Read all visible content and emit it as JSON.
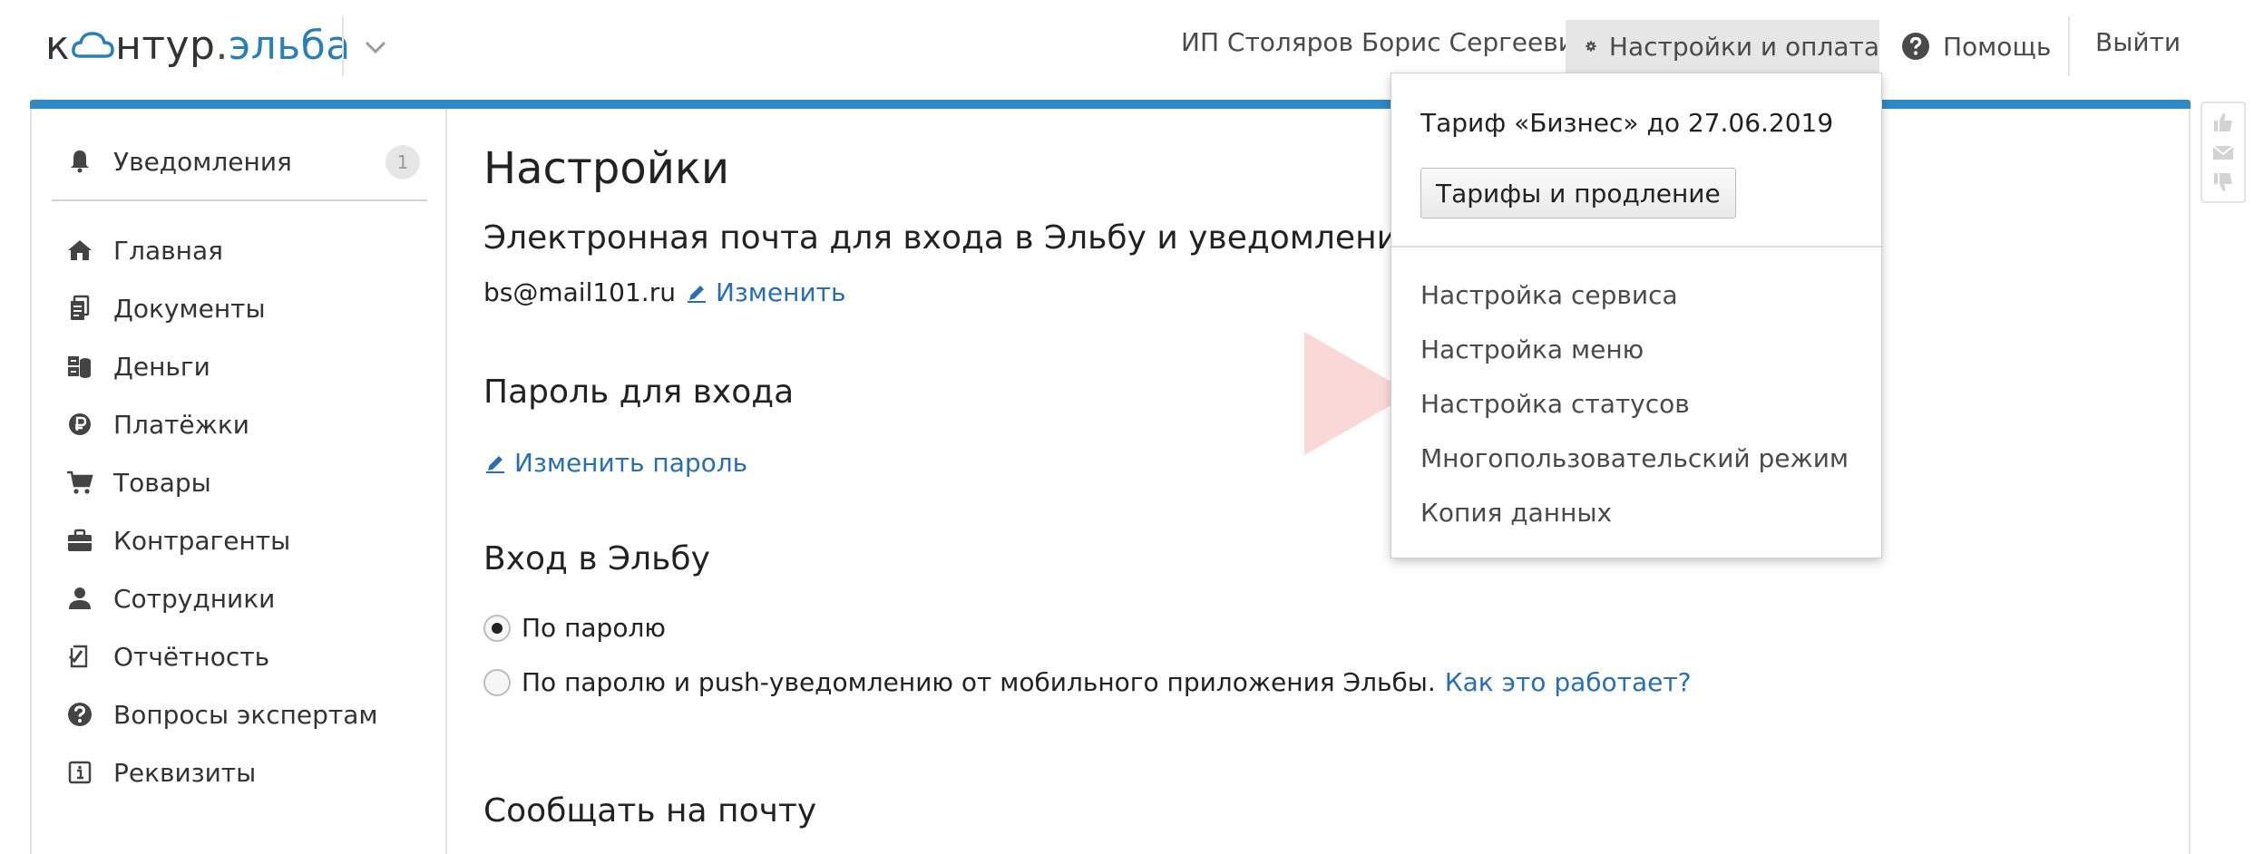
{
  "logo": {
    "part1": "к",
    "part2": "нтур",
    "dot": ".",
    "part3": "эльба"
  },
  "header": {
    "user": "ИП Столяров Борис Сергеевич",
    "settings_label": "Настройки и оплата",
    "help_label": "Помощь",
    "logout_label": "Выйти"
  },
  "sidebar": {
    "notifications": {
      "label": "Уведомления",
      "count": "1",
      "icon": "bell-icon"
    },
    "items": [
      {
        "label": "Главная",
        "icon": "home-icon"
      },
      {
        "label": "Документы",
        "icon": "documents-icon"
      },
      {
        "label": "Деньги",
        "icon": "money-icon"
      },
      {
        "label": "Платёжки",
        "icon": "payment-icon"
      },
      {
        "label": "Товары",
        "icon": "cart-icon"
      },
      {
        "label": "Контрагенты",
        "icon": "briefcase-icon"
      },
      {
        "label": "Сотрудники",
        "icon": "person-icon"
      },
      {
        "label": "Отчётность",
        "icon": "report-icon"
      },
      {
        "label": "Вопросы экспертам",
        "icon": "question-icon"
      },
      {
        "label": "Реквизиты",
        "icon": "info-icon"
      }
    ]
  },
  "main": {
    "title": "Настройки",
    "email_section": {
      "heading": "Электронная почта для входа в Эльбу и уведомлений",
      "email": "bs@mail101.ru",
      "change_link": "Изменить"
    },
    "password_section": {
      "heading": "Пароль для входа",
      "change_link": "Изменить пароль"
    },
    "login_section": {
      "heading": "Вход в Эльбу",
      "option1": "По паролю",
      "option2": "По паролю и push-уведомлению от мобильного приложения Эльбы.",
      "option2_link": "Как это работает?",
      "selected": "option1"
    },
    "notify_section": {
      "heading": "Сообщать на почту"
    }
  },
  "dropdown": {
    "tariff": "Тариф «Бизнес» до 27.06.2019",
    "tariff_button": "Тарифы и продление",
    "items": [
      "Настройка сервиса",
      "Настройка меню",
      "Настройка статусов",
      "Многопользовательский режим",
      "Копия данных"
    ]
  },
  "colors": {
    "accent_blue": "#2f89c4",
    "link": "#2b6eb0",
    "pointer_overlay": "#fbd4d4"
  }
}
